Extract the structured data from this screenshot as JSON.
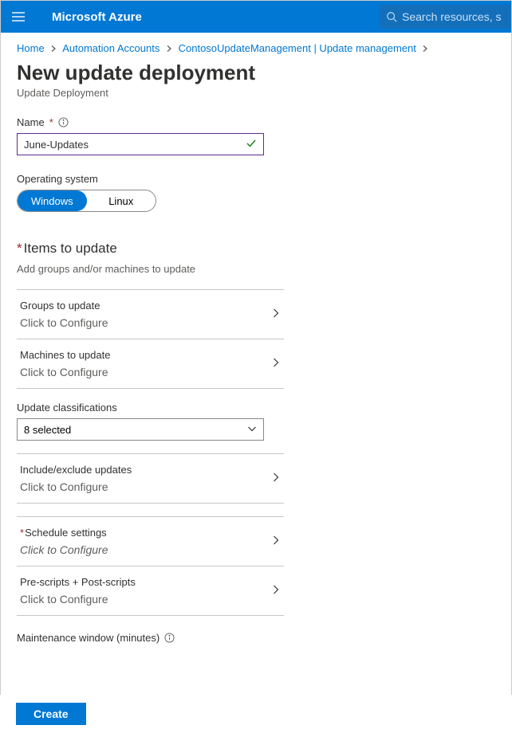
{
  "topbar": {
    "brand": "Microsoft Azure",
    "search_placeholder": "Search resources, s"
  },
  "breadcrumb": [
    "Home",
    "Automation Accounts",
    "ContosoUpdateManagement | Update management"
  ],
  "header": {
    "title": "New update deployment",
    "subtitle": "Update Deployment"
  },
  "name_field": {
    "label": "Name",
    "value": "June-Updates"
  },
  "os_field": {
    "label": "Operating system",
    "options": {
      "windows": "Windows",
      "linux": "Linux"
    },
    "selected": "windows"
  },
  "items_section": {
    "heading": "Items to update",
    "desc": "Add groups and/or machines to update"
  },
  "rows": {
    "groups": {
      "title": "Groups to update",
      "sub": "Click to Configure"
    },
    "machines": {
      "title": "Machines to update",
      "sub": "Click to Configure"
    },
    "include_exclude": {
      "title": "Include/exclude updates",
      "sub": "Click to Configure"
    },
    "schedule": {
      "title": "Schedule settings",
      "sub": "Click to Configure"
    },
    "scripts": {
      "title": "Pre-scripts + Post-scripts",
      "sub": "Click to Configure"
    }
  },
  "classifications": {
    "label": "Update classifications",
    "value": "8 selected"
  },
  "maintenance": {
    "label": "Maintenance window (minutes)"
  },
  "footer": {
    "create": "Create"
  }
}
